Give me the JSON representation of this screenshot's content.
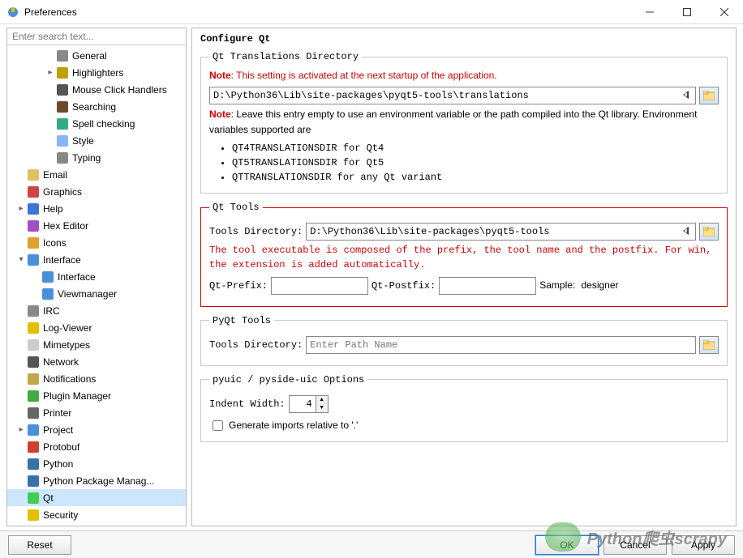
{
  "window": {
    "title": "Preferences"
  },
  "search": {
    "placeholder": "Enter search text..."
  },
  "tree": [
    {
      "label": "General",
      "depth": 2,
      "chev": "",
      "icon": "gear-icon",
      "color": "#888"
    },
    {
      "label": "Highlighters",
      "depth": 2,
      "chev": ">",
      "icon": "highlighter-icon",
      "color": "#c0a000"
    },
    {
      "label": "Mouse Click Handlers",
      "depth": 2,
      "chev": "",
      "icon": "mouse-icon",
      "color": "#555"
    },
    {
      "label": "Searching",
      "depth": 2,
      "chev": "",
      "icon": "binoculars-icon",
      "color": "#6b4a2b"
    },
    {
      "label": "Spell checking",
      "depth": 2,
      "chev": "",
      "icon": "spellcheck-icon",
      "color": "#3a8"
    },
    {
      "label": "Style",
      "depth": 2,
      "chev": "",
      "icon": "style-icon",
      "color": "#8ab4f8"
    },
    {
      "label": "Typing",
      "depth": 2,
      "chev": "",
      "icon": "keyboard-icon",
      "color": "#888"
    },
    {
      "label": "Email",
      "depth": 0,
      "chev": "",
      "icon": "email-icon",
      "color": "#e0c060"
    },
    {
      "label": "Graphics",
      "depth": 0,
      "chev": "",
      "icon": "graphics-icon",
      "color": "#c44"
    },
    {
      "label": "Help",
      "depth": 0,
      "chev": ">",
      "icon": "help-icon",
      "color": "#3a76d8"
    },
    {
      "label": "Hex Editor",
      "depth": 0,
      "chev": "",
      "icon": "hex-icon",
      "color": "#a050c0"
    },
    {
      "label": "Icons",
      "depth": 0,
      "chev": "",
      "icon": "icons-icon",
      "color": "#e0a030"
    },
    {
      "label": "Interface",
      "depth": 0,
      "chev": "v",
      "icon": "interface-icon",
      "color": "#4a90d9"
    },
    {
      "label": "Interface",
      "depth": 1,
      "chev": "",
      "icon": "interface-icon",
      "color": "#4a90d9"
    },
    {
      "label": "Viewmanager",
      "depth": 1,
      "chev": "",
      "icon": "viewmanager-icon",
      "color": "#4a90d9"
    },
    {
      "label": "IRC",
      "depth": 0,
      "chev": "",
      "icon": "irc-icon",
      "color": "#888"
    },
    {
      "label": "Log-Viewer",
      "depth": 0,
      "chev": "",
      "icon": "log-icon",
      "color": "#e0c000"
    },
    {
      "label": "Mimetypes",
      "depth": 0,
      "chev": "",
      "icon": "mimetypes-icon",
      "color": "#ccc"
    },
    {
      "label": "Network",
      "depth": 0,
      "chev": "",
      "icon": "network-icon",
      "color": "#555"
    },
    {
      "label": "Notifications",
      "depth": 0,
      "chev": "",
      "icon": "notifications-icon",
      "color": "#c0a848"
    },
    {
      "label": "Plugin Manager",
      "depth": 0,
      "chev": "",
      "icon": "plugin-icon",
      "color": "#4a4"
    },
    {
      "label": "Printer",
      "depth": 0,
      "chev": "",
      "icon": "printer-icon",
      "color": "#666"
    },
    {
      "label": "Project",
      "depth": 0,
      "chev": ">",
      "icon": "project-icon",
      "color": "#4a90d9"
    },
    {
      "label": "Protobuf",
      "depth": 0,
      "chev": "",
      "icon": "protobuf-icon",
      "color": "#d04030"
    },
    {
      "label": "Python",
      "depth": 0,
      "chev": "",
      "icon": "python-icon",
      "color": "#3572A5"
    },
    {
      "label": "Python Package Manag...",
      "depth": 0,
      "chev": "",
      "icon": "python-pkg-icon",
      "color": "#3572A5"
    },
    {
      "label": "Qt",
      "depth": 0,
      "chev": "",
      "icon": "qt-icon",
      "color": "#41cd52",
      "selected": true
    },
    {
      "label": "Security",
      "depth": 0,
      "chev": "",
      "icon": "security-icon",
      "color": "#e0c000"
    }
  ],
  "content": {
    "heading": "Configure Qt",
    "trans": {
      "legend": "Qt Translations Directory",
      "note_label": "Note",
      "note1": ": This setting is activated at the next startup of the application.",
      "path": "D:\\Python36\\Lib\\site-packages\\pyqt5-tools\\translations",
      "note2a": ": Leave this entry empty to use an environment variable or the path compiled into the Qt library. Environment variables supported are",
      "bullets": [
        "QT4TRANSLATIONSDIR for Qt4",
        "QT5TRANSLATIONSDIR for Qt5",
        "QTTRANSLATIONSDIR for any Qt variant"
      ]
    },
    "qttools": {
      "legend": "Qt Tools",
      "dir_label": "Tools Directory:",
      "dir_value": "D:\\Python36\\Lib\\site-packages\\pyqt5-tools",
      "desc": "The tool executable is composed of the prefix, the tool name and the postfix. For win, the extension is added automatically.",
      "prefix_label": "Qt-Prefix:",
      "prefix_value": "",
      "postfix_label": "Qt-Postfix:",
      "postfix_value": "",
      "sample_label": "Sample:",
      "sample_value": "designer"
    },
    "pyqt": {
      "legend": "PyQt Tools",
      "dir_label": "Tools Directory:",
      "placeholder": "Enter Path Name"
    },
    "pyuic": {
      "legend": "pyuic / pyside-uic Options",
      "indent_label": "Indent Width:",
      "indent_value": "4",
      "checkbox_label": "Generate imports relative to '.'"
    }
  },
  "footer": {
    "reset": "Reset",
    "ok": "OK",
    "cancel": "Cancel",
    "apply": "Apply"
  },
  "watermark": "Python爬虫scrapy"
}
